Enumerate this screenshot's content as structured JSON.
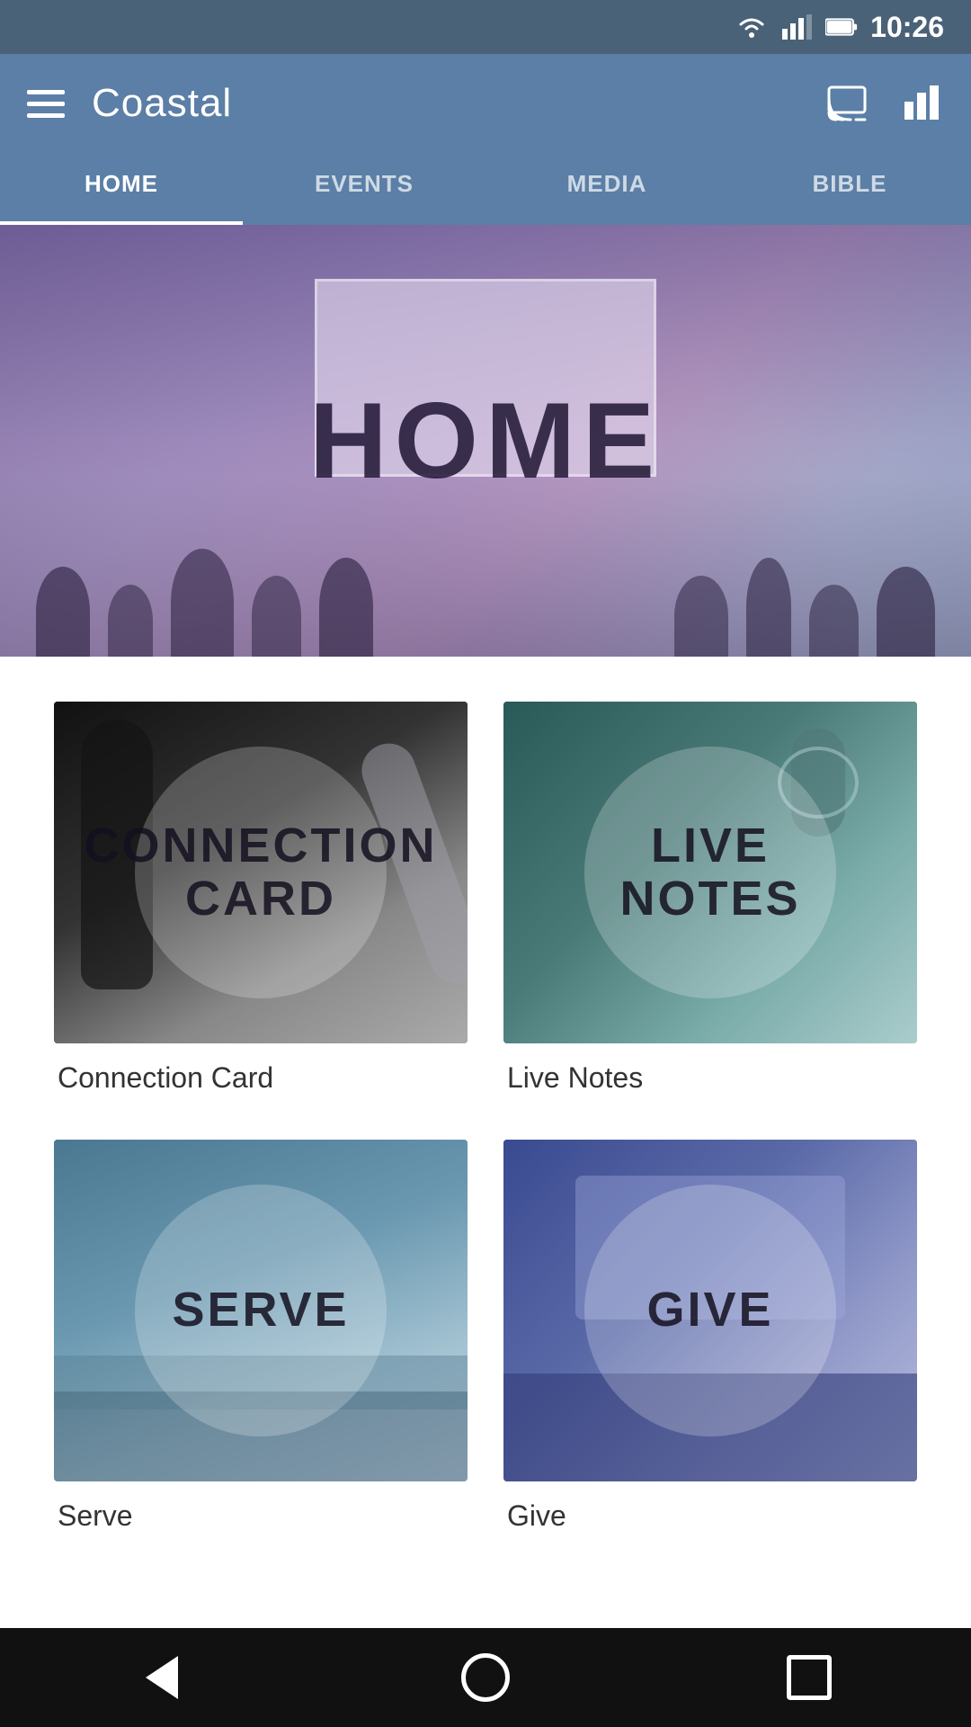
{
  "statusBar": {
    "time": "10:26"
  },
  "header": {
    "title": "Coastal",
    "menuLabel": "Menu",
    "castLabel": "Cast",
    "analyticsLabel": "Analytics"
  },
  "navTabs": [
    {
      "label": "HOME",
      "active": true
    },
    {
      "label": "EVENTS",
      "active": false
    },
    {
      "label": "MEDIA",
      "active": false
    },
    {
      "label": "BIBLE",
      "active": false
    }
  ],
  "hero": {
    "text": "HOME"
  },
  "cards": [
    {
      "id": "connection-card",
      "overlayLabel": "CONNECTION\nCARD",
      "title": "Connection Card"
    },
    {
      "id": "live-notes",
      "overlayLabel": "LIVE\nNOTES",
      "title": "Live Notes"
    },
    {
      "id": "serve",
      "overlayLabel": "SERVE",
      "title": "Serve"
    },
    {
      "id": "give",
      "overlayLabel": "GIVE",
      "title": "Give"
    }
  ],
  "bottomNav": {
    "backLabel": "Back",
    "homeLabel": "Home",
    "squareLabel": "Recent Apps"
  }
}
